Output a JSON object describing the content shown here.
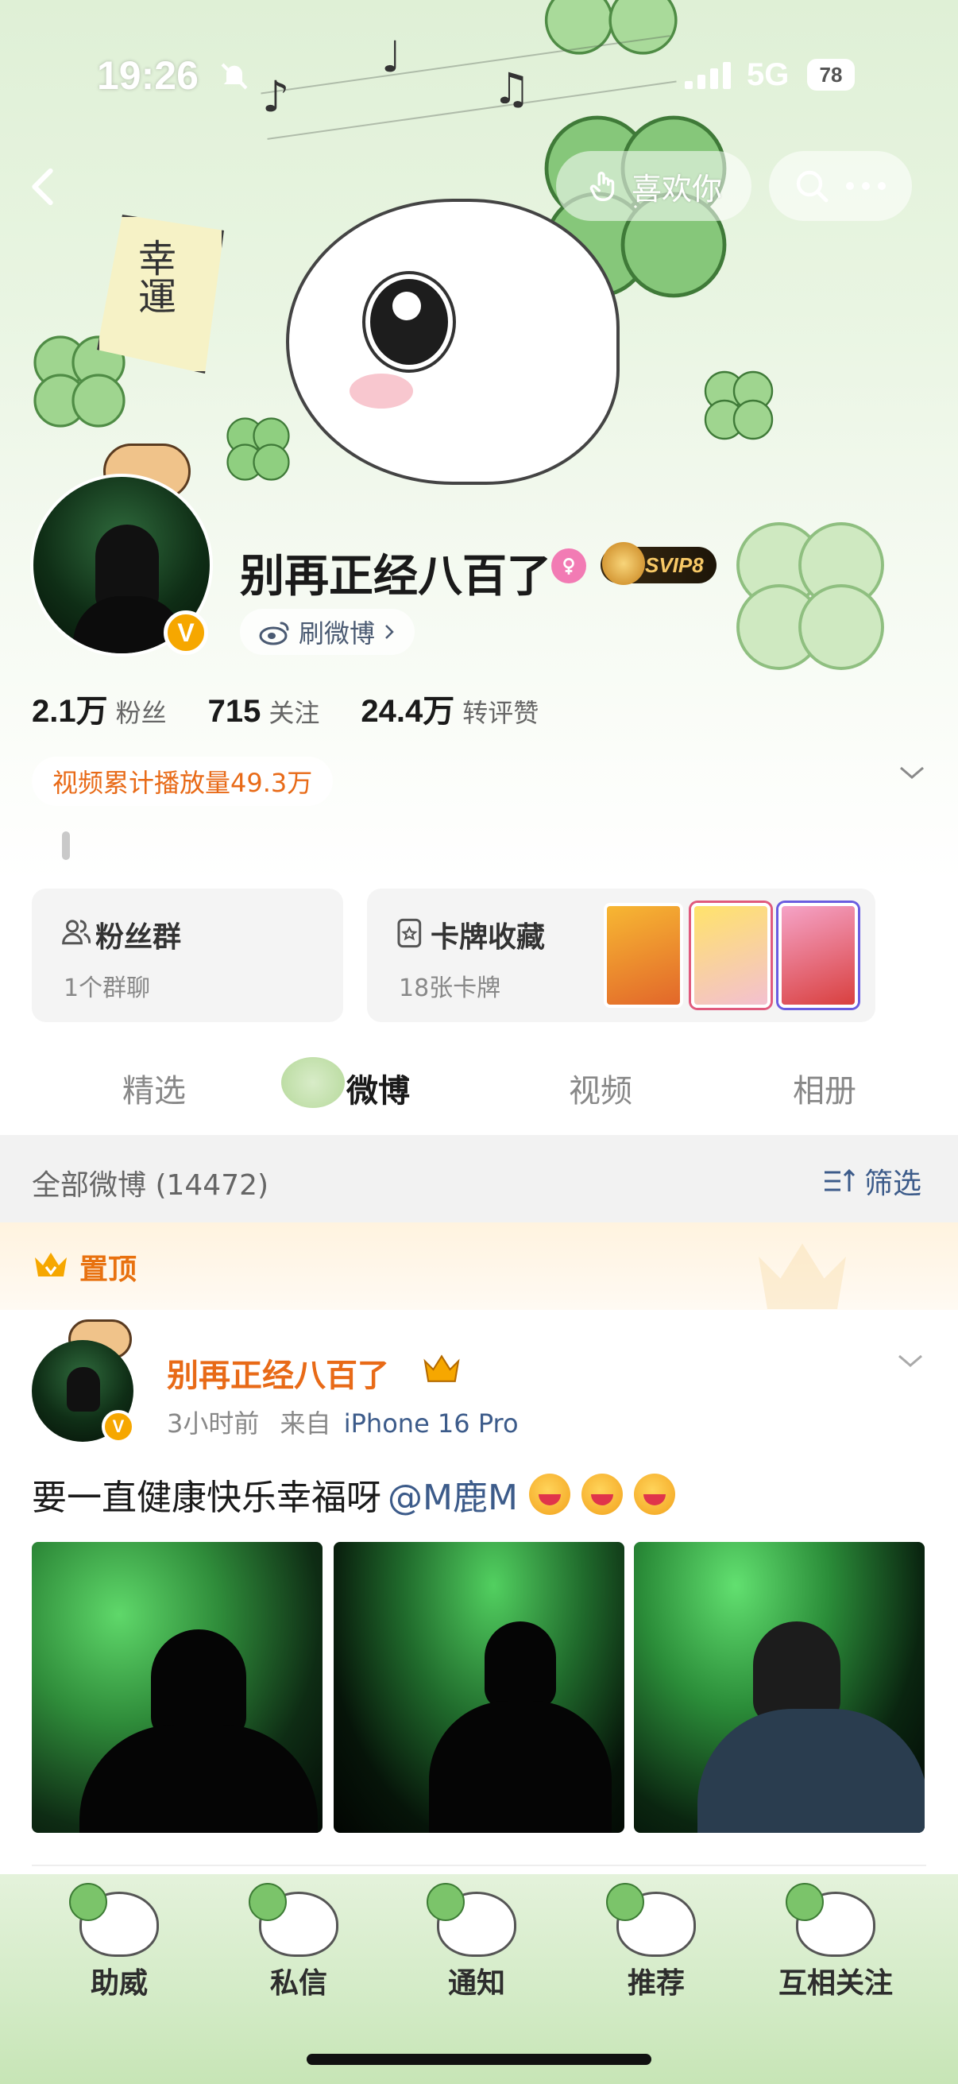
{
  "status_bar": {
    "time": "19:26",
    "network": "5G",
    "battery": "78"
  },
  "header": {
    "like_label": "喜欢你",
    "charm_text": "幸運"
  },
  "profile": {
    "name": "别再正经八百了",
    "vip_level": "SVIP8",
    "verified_mark": "V",
    "weibo_link": "刷微博",
    "stats": [
      {
        "value": "2.1万",
        "label": "粉丝"
      },
      {
        "value": "715",
        "label": "关注"
      },
      {
        "value": "24.4万",
        "label": "转评赞"
      }
    ],
    "video_plays": "视频累计播放量49.3万"
  },
  "cards": {
    "fans_group": {
      "title": "粉丝群",
      "subtitle": "1个群聊"
    },
    "card_collection": {
      "title": "卡牌收藏",
      "subtitle": "18张卡牌"
    }
  },
  "tabs": [
    {
      "label": "精选",
      "active": false
    },
    {
      "label": "微博",
      "active": true
    },
    {
      "label": "视频",
      "active": false
    },
    {
      "label": "相册",
      "active": false
    }
  ],
  "filter": {
    "all_label": "全部微博 (14472)",
    "filter_label": "筛选"
  },
  "pinned": {
    "label": "置顶"
  },
  "post": {
    "author": "别再正经八百了",
    "time_ago": "3小时前",
    "source_prefix": "来自",
    "device": "iPhone 16 Pro",
    "text": "要一直健康快乐幸福呀",
    "mention": "@M鹿M",
    "emoji_count": 3
  },
  "bottom_nav": [
    {
      "label": "助威"
    },
    {
      "label": "私信"
    },
    {
      "label": "通知"
    },
    {
      "label": "推荐"
    },
    {
      "label": "互相关注"
    }
  ],
  "colors": {
    "accent_orange": "#e86a17",
    "link_blue": "#3c5b8a",
    "verified_gold": "#f6a700",
    "theme_green": "#7bc46a"
  }
}
